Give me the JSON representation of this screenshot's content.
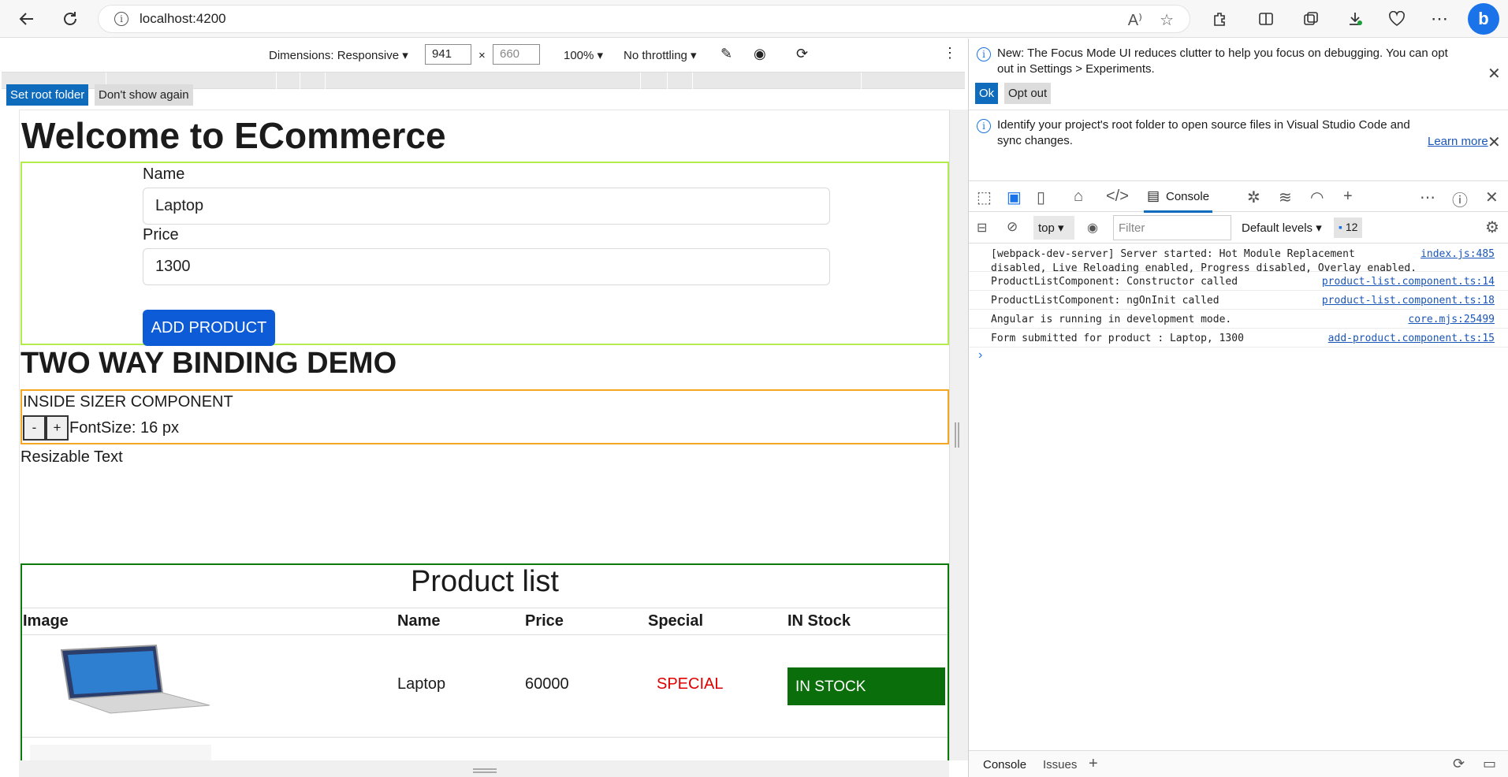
{
  "browser": {
    "url": "localhost:4200"
  },
  "device_toolbar": {
    "dimensions_label": "Dimensions: Responsive",
    "width_value": "941",
    "times": "×",
    "height_placeholder": "660",
    "zoom": "100%",
    "throttling": "No throttling"
  },
  "app": {
    "title": "Welcome to ECommerce",
    "form": {
      "name_label": "Name",
      "name_value": "Laptop",
      "price_label": "Price",
      "price_value": "1300",
      "add_button": "ADD PRODUCT"
    },
    "two_way_title": "TWO WAY BINDING DEMO",
    "sizer": {
      "heading": "INSIDE SIZER COMPONENT",
      "minus": "-",
      "plus": "+",
      "font_size_text": "FontSize: 16 px"
    },
    "resizable_text": "Resizable Text",
    "product_list": {
      "title": "Product list",
      "columns": [
        "Image",
        "Name",
        "Price",
        "Special",
        "IN Stock"
      ],
      "rows": [
        {
          "name": "Laptop",
          "price": "60000",
          "special": "SPECIAL",
          "stock": "IN STOCK"
        }
      ]
    }
  },
  "devtools": {
    "focus_notice": "New: The Focus Mode UI reduces clutter to help you focus on debugging. You can opt out in Settings > Experiments.",
    "ok": "Ok",
    "opt_out": "Opt out",
    "root_notice": "Identify your project's root folder to open source files in Visual Studio Code and sync changes.",
    "learn_more": "Learn more",
    "set_root": "Set root folder",
    "dont_show": "Don't show again",
    "console_tab": "Console",
    "context": "top",
    "filter_placeholder": "Filter",
    "levels": "Default levels",
    "issue_count": "12",
    "messages": [
      {
        "text": "[webpack-dev-server] Server started: Hot Module Replacement",
        "text2": "disabled, Live Reloading enabled, Progress disabled, Overlay enabled.",
        "src": "index.js:485"
      },
      {
        "text": "ProductListComponent: Constructor called",
        "src": "product-list.component.ts:14"
      },
      {
        "text": "ProductListComponent: ngOnInit called",
        "src": "product-list.component.ts:18"
      },
      {
        "text": "Angular is running in development mode.",
        "src": "core.mjs:25499"
      },
      {
        "text": "Form submitted for product : Laptop, 1300",
        "src": "add-product.component.ts:15"
      }
    ],
    "prompt": "›",
    "drawer_console": "Console",
    "drawer_issues": "Issues"
  },
  "colors": {
    "accent": "#0d5bd6",
    "form_border": "#b2ec4d",
    "sizer_border": "#f5a623",
    "list_border": "#0b7a0b",
    "special_red": "#e00000",
    "instock_green": "#0a6e0a"
  }
}
